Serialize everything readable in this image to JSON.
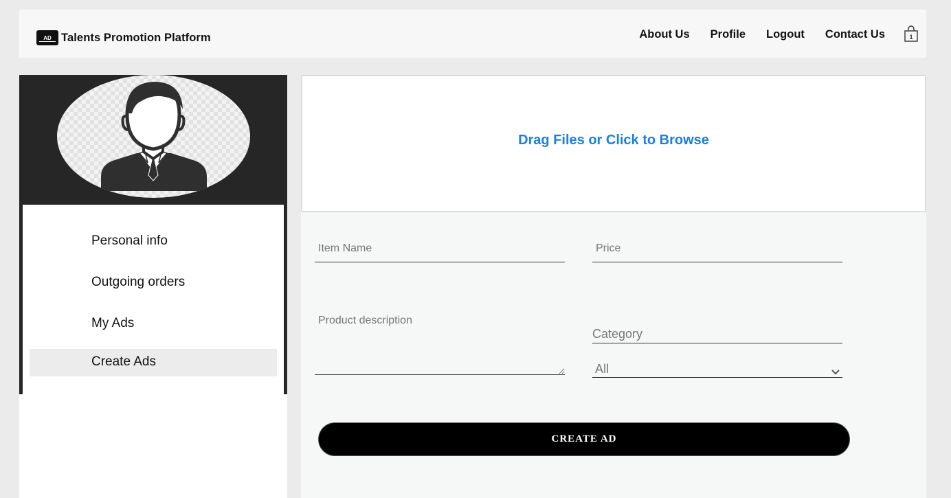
{
  "brand": {
    "logo_text": "AD",
    "title": "Talents Promotion Platform"
  },
  "nav": {
    "items": [
      {
        "label": "About Us"
      },
      {
        "label": "Profile"
      },
      {
        "label": "Logout"
      },
      {
        "label": "Contact Us"
      }
    ],
    "cart_icon": "shopping-bag-icon",
    "cart_count": "1"
  },
  "sidebar": {
    "avatar_icon": "user-avatar-icon",
    "items": [
      {
        "label": "Personal info"
      },
      {
        "label": "Outgoing orders"
      },
      {
        "label": "My Ads"
      },
      {
        "label": "Create Ads",
        "active": true
      }
    ]
  },
  "upload": {
    "label": "Drag Files or Click to Browse"
  },
  "form": {
    "item_name_placeholder": "Item Name",
    "price_placeholder": "Price",
    "description_placeholder": "Product description",
    "category_label": "Category",
    "category_selected": "All",
    "submit_label": "CREATE AD"
  },
  "colors": {
    "accent": "#1a80e6",
    "sidebar_dark": "#262626",
    "active_item_bg": "#ececec",
    "button_bg": "#000000"
  }
}
